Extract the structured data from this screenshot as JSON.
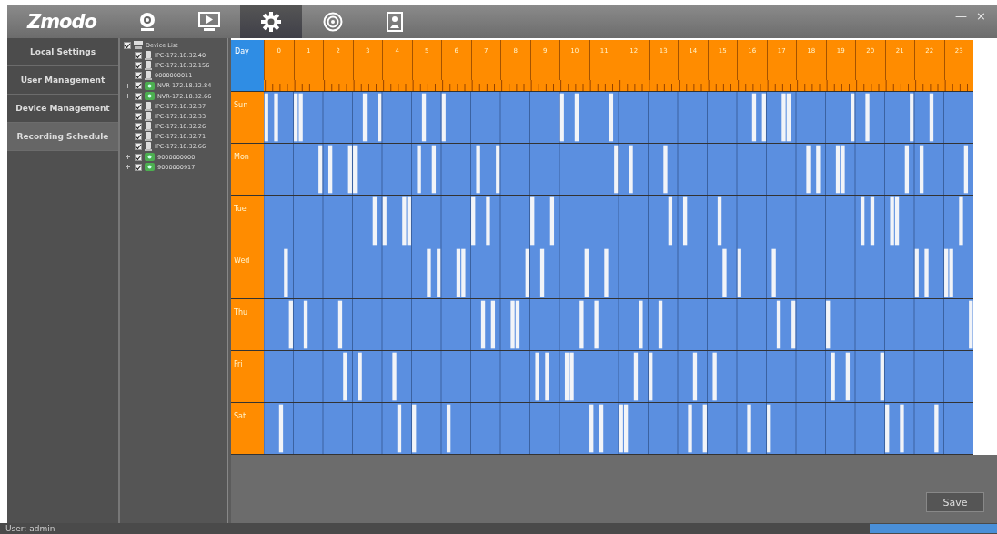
{
  "window": {
    "logo": "Zmodo",
    "controls": [
      "—",
      "×"
    ]
  },
  "nav": [
    {
      "kind": "camera",
      "selected": false
    },
    {
      "kind": "playback",
      "selected": false
    },
    {
      "kind": "settings",
      "selected": true
    },
    {
      "kind": "disc",
      "selected": false
    },
    {
      "kind": "person",
      "selected": false
    }
  ],
  "sidebar": {
    "items": [
      {
        "label": "Local Settings",
        "selected": false
      },
      {
        "label": "User Management",
        "selected": false
      },
      {
        "label": "Device Management",
        "selected": false
      },
      {
        "label": "Recording Schedule",
        "selected": true
      }
    ]
  },
  "device_tree": {
    "label": "Device List",
    "checked": true,
    "children": [
      {
        "label": "IPC-172.18.32.40",
        "kind": "camera",
        "checked": true
      },
      {
        "label": "IPC-172.18.32.156",
        "kind": "camera",
        "checked": true
      },
      {
        "label": "9000000011",
        "kind": "camera",
        "checked": true
      },
      {
        "label": "NVR-172.18.32.84",
        "kind": "nvr",
        "checked": true,
        "expanded": false
      },
      {
        "label": "NVR-172.18.32.66",
        "kind": "nvr",
        "checked": true,
        "expanded": false
      },
      {
        "label": "IPC-172.18.32.37",
        "kind": "camera",
        "checked": true
      },
      {
        "label": "IPC-172.18.32.33",
        "kind": "camera",
        "checked": true
      },
      {
        "label": "IPC-172.18.32.26",
        "kind": "camera",
        "checked": true
      },
      {
        "label": "IPC-172.18.32.71",
        "kind": "camera",
        "checked": true
      },
      {
        "label": "IPC-172.18.32.66",
        "kind": "camera",
        "checked": true
      },
      {
        "label": "9000000000",
        "kind": "nvr",
        "checked": true,
        "expanded": false
      },
      {
        "label": "9000000917",
        "kind": "nvr",
        "checked": true,
        "expanded": false
      }
    ]
  },
  "schedule": {
    "corner": "Day",
    "hours": [
      "0",
      "1",
      "2",
      "3",
      "4",
      "5",
      "6",
      "7",
      "8",
      "9",
      "10",
      "11",
      "12",
      "13",
      "14",
      "15",
      "16",
      "17",
      "18",
      "19",
      "20",
      "21",
      "22",
      "23"
    ],
    "days": [
      "Sun",
      "Mon",
      "Tue",
      "Wed",
      "Thu",
      "Fri",
      "Sat"
    ]
  },
  "save_button": "Save",
  "status_bar": {
    "user": "User: admin"
  }
}
